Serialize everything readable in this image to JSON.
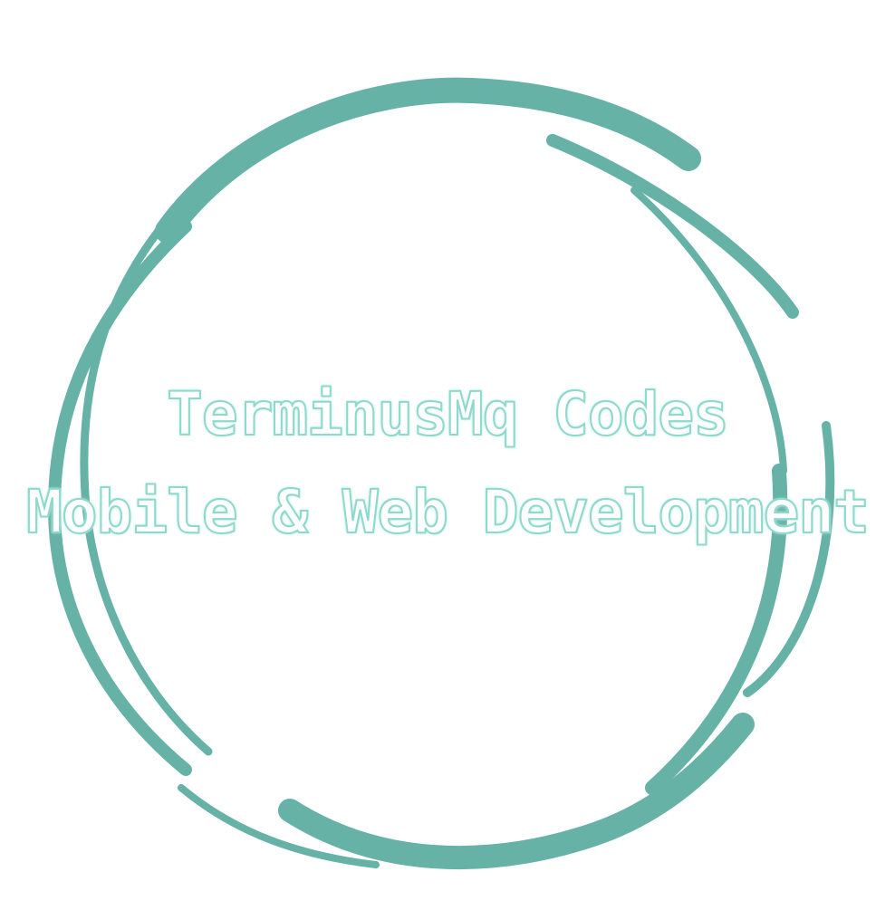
{
  "logo": {
    "line1": "TerminusMq Codes",
    "line2": "Mobile & Web Development"
  },
  "colors": {
    "ring": "#66b2a6",
    "text_fill": "#ffffff",
    "text_outline": "#8fd9cc",
    "background": "#ffffff"
  },
  "icons": {
    "ring": "brush-stroke-circle"
  }
}
